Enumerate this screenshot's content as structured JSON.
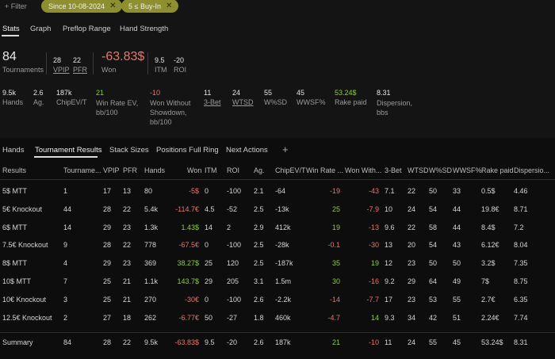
{
  "filters": {
    "filter_label": "Filter",
    "chips": [
      "Since 10-08-2024",
      "5 ≤ Buy-In"
    ]
  },
  "top_tabs": [
    "Stats",
    "Graph",
    "Preflop Range",
    "Hand Strength"
  ],
  "summary": {
    "tournaments": {
      "value": "84",
      "label": "Tournaments"
    },
    "vpip": {
      "value": "28",
      "label": "VPIP"
    },
    "pfr": {
      "value": "22",
      "label": "PFR"
    },
    "won": {
      "value": "-63.83$",
      "label": "Won"
    },
    "itm": {
      "value": "9.5",
      "label": "ITM"
    },
    "roi": {
      "value": "-20",
      "label": "ROI"
    }
  },
  "stats_row": [
    {
      "value": "9.5k",
      "label": "Hands"
    },
    {
      "value": "2.6",
      "label": "Ag."
    },
    {
      "value": "187k",
      "label": "ChipEV/T"
    },
    {
      "value": "21",
      "label": "Win Rate EV, bb/100"
    },
    {
      "value": "-10",
      "label": "Won Without Showdown, bb/100"
    },
    {
      "value": "11",
      "label": "3-Bet"
    },
    {
      "value": "24",
      "label": "WTSD"
    },
    {
      "value": "55",
      "label": "W%SD"
    },
    {
      "value": "45",
      "label": "WWSF%"
    },
    {
      "value": "53.24$",
      "label": "Rake paid"
    },
    {
      "value": "8.31",
      "label": "Dispersion, bbs"
    }
  ],
  "bottom_tabs": [
    "Hands",
    "Tournament Results",
    "Stack Sizes",
    "Positions Full Ring",
    "Next Actions",
    "+"
  ],
  "table": {
    "columns": [
      "Results",
      "Tourname...",
      "VPIP",
      "PFR",
      "Hands",
      "Won",
      "ITM",
      "ROI",
      "Ag.",
      "ChipEV/T",
      "Win Rate ...",
      "Won With...",
      "3-Bet",
      "WTSD",
      "W%SD",
      "WWSF%",
      "Rake paid",
      "Dispersio..."
    ],
    "rows": [
      [
        "5$ MTT",
        "1",
        "17",
        "13",
        "80",
        "-5$",
        "0",
        "-100",
        "2.1",
        "-64",
        "-19",
        "-43",
        "7.1",
        "22",
        "50",
        "33",
        "0.5$",
        "4.46"
      ],
      [
        "5€ Knockout",
        "44",
        "28",
        "22",
        "5.4k",
        "-114.7€",
        "4.5",
        "-52",
        "2.5",
        "-13k",
        "25",
        "-7.9",
        "10",
        "24",
        "54",
        "44",
        "19.8€",
        "8.71"
      ],
      [
        "6$ MTT",
        "14",
        "29",
        "23",
        "1.3k",
        "1.43$",
        "14",
        "2",
        "2.9",
        "412k",
        "19",
        "-13",
        "9.6",
        "22",
        "58",
        "44",
        "8.4$",
        "7.2"
      ],
      [
        "7.5€ Knockout",
        "9",
        "28",
        "22",
        "778",
        "-67.5€",
        "0",
        "-100",
        "2.5",
        "-28k",
        "-0.1",
        "-30",
        "13",
        "20",
        "54",
        "43",
        "6.12€",
        "8.04"
      ],
      [
        "8$ MTT",
        "4",
        "29",
        "23",
        "369",
        "38.27$",
        "25",
        "120",
        "2.5",
        "-187k",
        "35",
        "19",
        "12",
        "23",
        "50",
        "50",
        "3.2$",
        "7.35"
      ],
      [
        "10$ MTT",
        "7",
        "25",
        "21",
        "1.1k",
        "143.7$",
        "29",
        "205",
        "3.1",
        "1.5m",
        "30",
        "-16",
        "9.2",
        "29",
        "64",
        "49",
        "7$",
        "8.75"
      ],
      [
        "10€ Knockout",
        "3",
        "25",
        "21",
        "270",
        "-30€",
        "0",
        "-100",
        "2.6",
        "-2.2k",
        "-14",
        "-7.7",
        "17",
        "23",
        "53",
        "55",
        "2.7€",
        "6.35"
      ],
      [
        "12.5€ Knockout",
        "2",
        "27",
        "18",
        "262",
        "-6.77€",
        "50",
        "-27",
        "1.8",
        "460k",
        "-4.7",
        "14",
        "9.3",
        "34",
        "42",
        "51",
        "2.24€",
        "7.74"
      ]
    ],
    "summary_row": [
      "Summary",
      "84",
      "28",
      "22",
      "9.5k",
      "-63.83$",
      "9.5",
      "-20",
      "2.6",
      "187k",
      "21",
      "-10",
      "11",
      "24",
      "55",
      "45",
      "53.24$",
      "8.31"
    ]
  },
  "colors": {
    "negative": "#e9756c",
    "positive": "#8fcc3c",
    "chip": "#8e8f2e"
  }
}
